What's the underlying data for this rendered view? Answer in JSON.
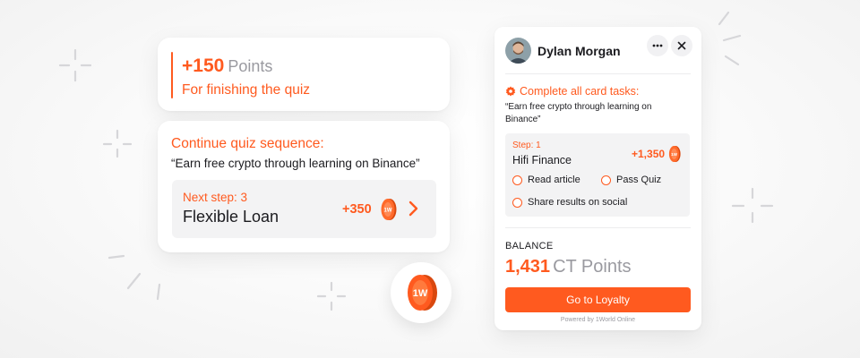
{
  "colors": {
    "accent": "#ff5a1f",
    "muted": "#9a9aa0",
    "panel": "#f3f3f4"
  },
  "points_card": {
    "amount": "+150",
    "unit": "Points",
    "subtitle": "For finishing the quiz"
  },
  "quiz_card": {
    "title": "Continue quiz sequence:",
    "quote": "“Earn free crypto through learning on Binance”",
    "next_step_label": "Next step: 3",
    "next_step_name": "Flexible Loan",
    "reward": "+350",
    "coin_icon": "coin-icon",
    "arrow_icon": "chevron-right-icon"
  },
  "big_coin": {
    "icon": "coin-icon"
  },
  "widget": {
    "user_name": "Dylan Morgan",
    "avatar_icon": "avatar",
    "more_icon": "more-horizontal-icon",
    "close_icon": "close-icon",
    "task_icon": "badge-icon",
    "task_title": "Complete all card tasks:",
    "task_desc": "“Earn free crypto through learning on Binance”",
    "step_label": "Step: 1",
    "step_name": "Hifi Finance",
    "step_reward": "+1,350",
    "options": [
      {
        "label": "Read article"
      },
      {
        "label": "Pass Quiz"
      },
      {
        "label": "Share results on social"
      }
    ],
    "balance_label": "BALANCE",
    "balance_value": "1,431",
    "balance_unit": "CT Points",
    "cta_label": "Go to Loyalty",
    "powered_by": "Powered by 1World Online"
  }
}
